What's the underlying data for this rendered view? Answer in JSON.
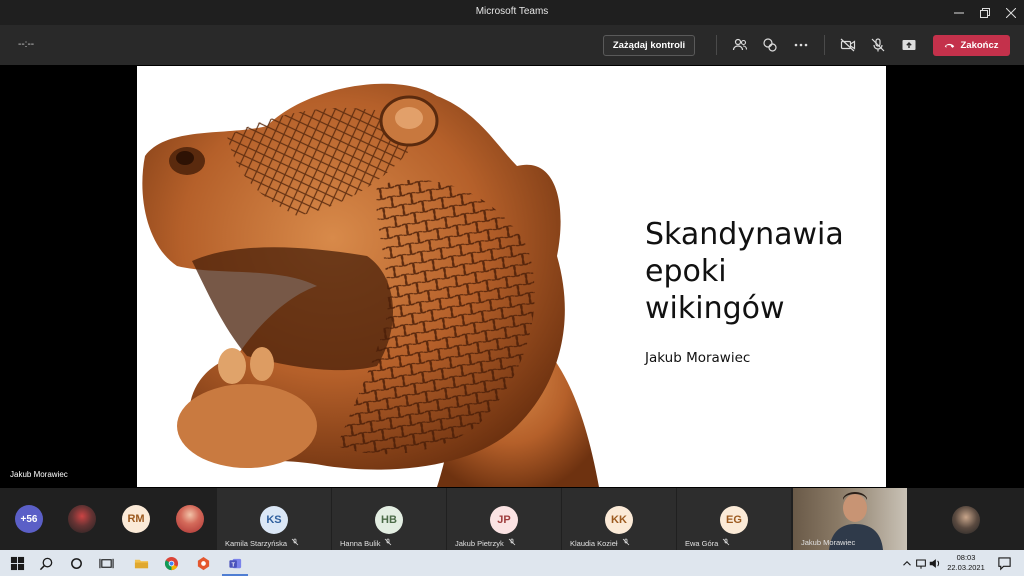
{
  "window": {
    "title": "Microsoft Teams"
  },
  "toolbar": {
    "timer": "--:--",
    "control_label": "Zażądaj kontroli",
    "end_label": "Zakończ",
    "end_color": "#c4314b"
  },
  "stage": {
    "presenter_name": "Jakub Morawiec",
    "slide": {
      "title_lines": [
        "Skandynawia",
        "epoki",
        "wikingów"
      ],
      "author": "Jakub Morawiec"
    }
  },
  "participants": {
    "overflow_count": "+56",
    "initials_rm": "RM",
    "tiles": [
      {
        "initials": "KS",
        "name": "Kamila Starzyńska",
        "color": "#dbe7f6",
        "text_color": "#2f5f9e"
      },
      {
        "initials": "HB",
        "name": "Hanna Bulik",
        "color": "#e3eee2",
        "text_color": "#4b6b47"
      },
      {
        "initials": "JP",
        "name": "Jakub Pietrzyk",
        "color": "#fbe3e3",
        "text_color": "#9e3d3d"
      },
      {
        "initials": "KK",
        "name": "Klaudia Kozieł",
        "color": "#fbead7",
        "text_color": "#9c5a1f"
      },
      {
        "initials": "EG",
        "name": "Ewa Góra",
        "color": "#fbead7",
        "text_color": "#9c5a1f"
      }
    ],
    "video_name": "Jakub Morawiec"
  },
  "taskbar": {
    "time": "08:03",
    "date": "22.03.2021"
  }
}
